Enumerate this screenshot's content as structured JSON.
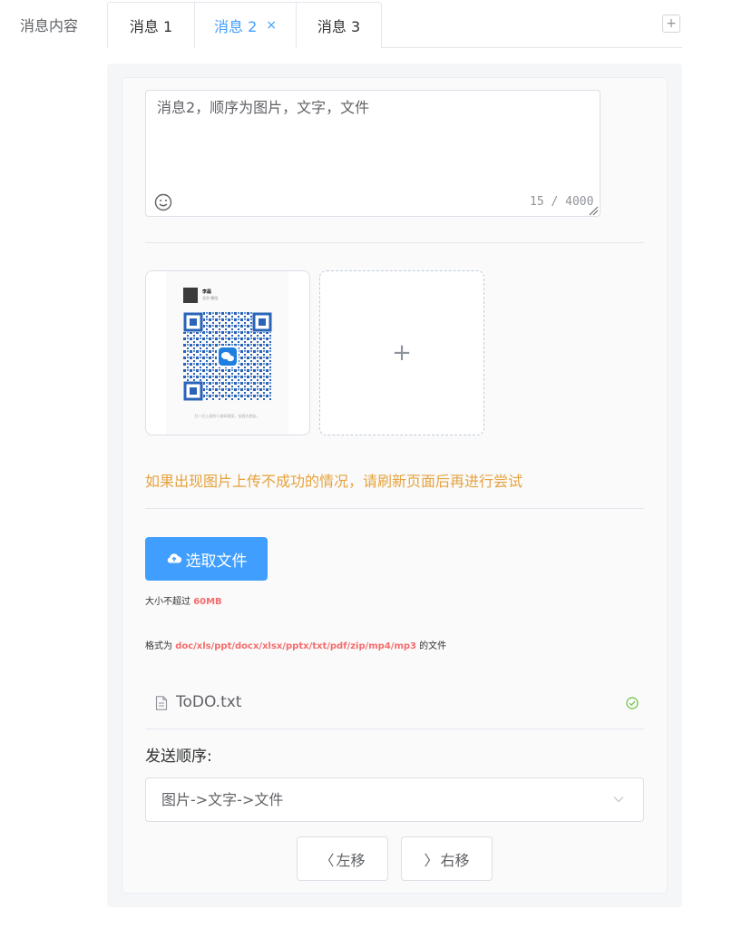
{
  "form": {
    "label": "消息内容"
  },
  "tabs": [
    {
      "label": "消息 1",
      "active": false
    },
    {
      "label": "消息 2",
      "active": true,
      "close": "×"
    },
    {
      "label": "消息 3",
      "active": false
    }
  ],
  "add_tab": "+",
  "message": {
    "text": "消息2，顺序为图片，文字，文件",
    "count": "15 / 4000"
  },
  "images": {
    "qr_name": "李磊",
    "qr_sub": "北京 朝阳",
    "qr_caption": "扫一扫上面的二维码图案，加我为朋友。",
    "upload_plus": "+"
  },
  "warning": "如果出现图片上传不成功的情况，请刷新页面后再进行尝试",
  "file_upload": {
    "button_label": "选取文件",
    "size_prefix": "大小不超过 ",
    "size_value": "60MB",
    "format_prefix": "格式为 ",
    "format_value": "doc/xls/ppt/docx/xlsx/pptx/txt/pdf/zip/mp4/mp3",
    "format_suffix": " 的文件",
    "files": [
      {
        "name": "ToDO.txt",
        "status": "success"
      }
    ]
  },
  "order": {
    "label": "发送顺序:",
    "value": "图片->文字->文件"
  },
  "buttons": {
    "left_icon": "〈",
    "left_label": "左移",
    "right_icon": "〉",
    "right_label": "右移"
  },
  "colors": {
    "primary": "#409eff",
    "warning": "#e6a23c",
    "danger": "#f56c6c",
    "success": "#67c23a"
  }
}
